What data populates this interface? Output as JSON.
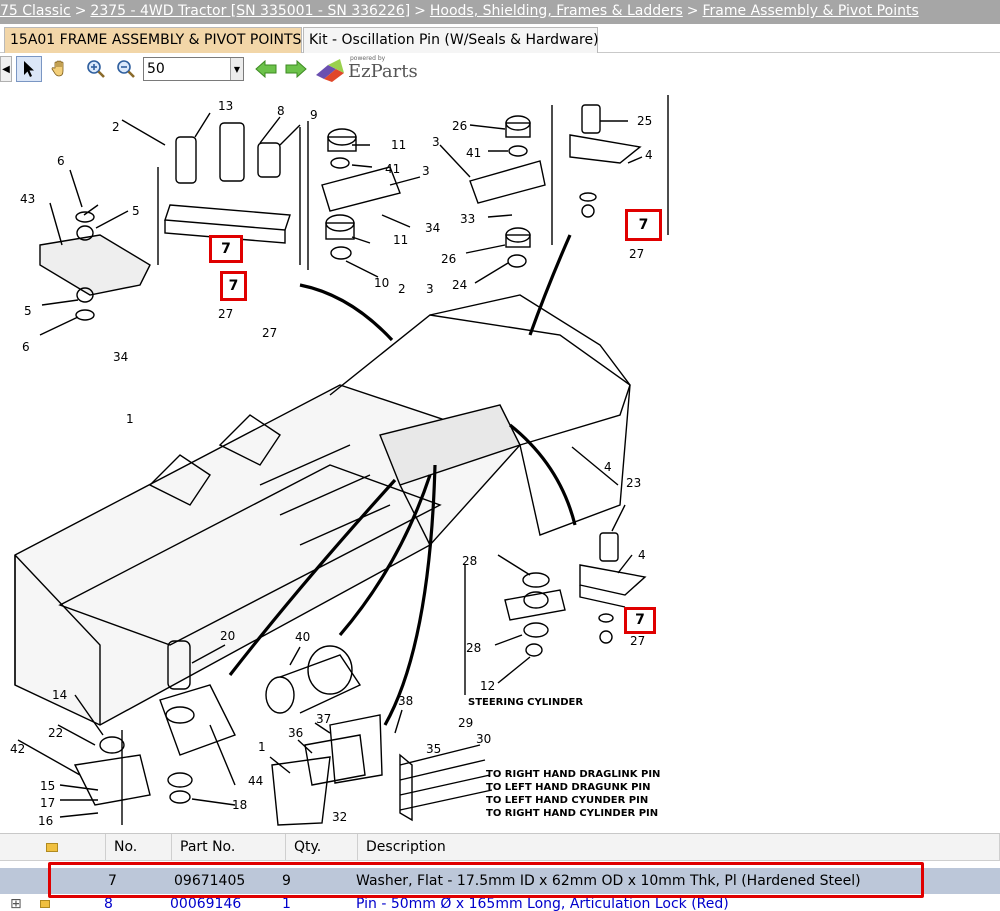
{
  "breadcrumb": {
    "items": [
      "75 Classic",
      "2375 - 4WD Tractor [SN 335001 - SN 336226]",
      "Hoods, Shielding, Frames & Ladders",
      "Frame Assembly & Pivot Points"
    ],
    "prefix": ":"
  },
  "tabs": [
    {
      "label": "15A01 FRAME ASSEMBLY & PIVOT POINTS",
      "active": true
    },
    {
      "label": "Kit - Oscillation Pin (W/Seals & Hardware)",
      "active": false
    }
  ],
  "toolbar": {
    "zoom_value": "50",
    "icons": [
      "select-arrow-icon",
      "pan-hand-icon",
      "zoom-in-icon",
      "zoom-out-icon",
      "back-arrow-icon",
      "forward-arrow-icon"
    ],
    "brand_powered": "powered by",
    "brand_name": "EzParts"
  },
  "diagram": {
    "labels": [
      "13",
      "8",
      "9",
      "2",
      "11",
      "41",
      "3",
      "34",
      "11",
      "10",
      "26",
      "41",
      "3",
      "33",
      "26",
      "24",
      "25",
      "4",
      "7",
      "27",
      "6",
      "43",
      "5",
      "5",
      "6",
      "7",
      "7",
      "27",
      "27",
      "34",
      "2",
      "3",
      "1",
      "4",
      "23",
      "28",
      "4",
      "7",
      "28",
      "27",
      "12",
      "20",
      "40",
      "38",
      "14",
      "22",
      "42",
      "15",
      "17",
      "16",
      "44",
      "18",
      "1",
      "36",
      "37",
      "35",
      "29",
      "30",
      "32"
    ],
    "callout": "7",
    "steering_cylinder": "STEERING CYLINDER",
    "pin_labels": [
      "TO RIGHT HAND DRAGLINK PIN",
      "TO LEFT HAND DRAGUNK PIN",
      "TO LEFT HAND CYUNDER PIN",
      "TO RIGHT HAND CYLINDER PIN"
    ]
  },
  "table": {
    "headers": [
      "No.",
      "Part No.",
      "Qty.",
      "Description"
    ],
    "rows": [
      {
        "no": "7",
        "part": "09671405",
        "qty": "9",
        "desc": "Washer, Flat - 17.5mm ID x 62mm OD x 10mm Thk, Pl (Hardened Steel)",
        "selected": true
      },
      {
        "no": "8",
        "part": "00069146",
        "qty": "1",
        "desc": "Pin - 50mm Ø x 165mm Long, Articulation Lock (Red)",
        "selected": false
      }
    ]
  },
  "colors": {
    "highlight": "#e00000",
    "selected_row": "#bcc7d9",
    "active_tab": "#f2d6a8",
    "breadcrumb_bg": "#a6a6a6"
  }
}
